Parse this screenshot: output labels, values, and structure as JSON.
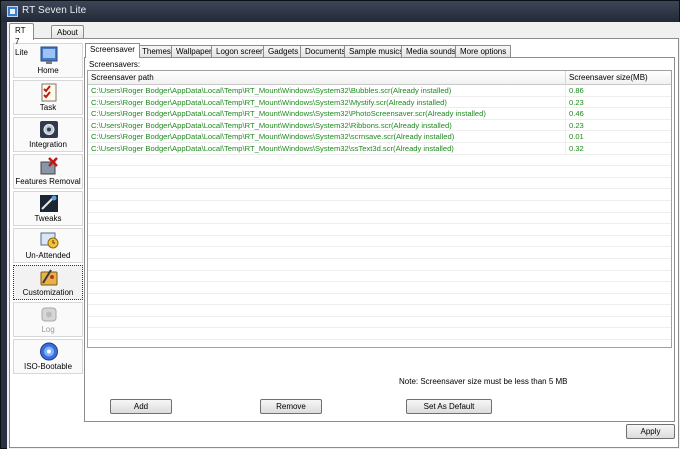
{
  "window": {
    "title": "RT Seven Lite"
  },
  "outer_tabs": [
    {
      "label": "RT 7 Lite",
      "active": true
    },
    {
      "label": "About",
      "active": false
    }
  ],
  "sidebar": {
    "items": [
      {
        "label": "Home",
        "icon": "home-icon"
      },
      {
        "label": "Task",
        "icon": "task-checklist-icon"
      },
      {
        "label": "Integration",
        "icon": "integration-gear-icon"
      },
      {
        "label": "Features Removal",
        "icon": "features-removal-icon"
      },
      {
        "label": "Tweaks",
        "icon": "tweaks-icon"
      },
      {
        "label": "Un-Attended",
        "icon": "unattended-icon"
      },
      {
        "label": "Customization",
        "icon": "customization-icon",
        "selected": true
      },
      {
        "label": "Log",
        "icon": "log-icon",
        "disabled": true
      },
      {
        "label": "ISO-Bootable",
        "icon": "iso-disc-icon"
      }
    ]
  },
  "inner_tabs": [
    {
      "label": "Screensaver",
      "active": true
    },
    {
      "label": "Themes"
    },
    {
      "label": "Wallpaper"
    },
    {
      "label": "Logon screen"
    },
    {
      "label": "Gadgets"
    },
    {
      "label": "Documents"
    },
    {
      "label": "Sample musics"
    },
    {
      "label": "Media sounds"
    },
    {
      "label": "More options"
    }
  ],
  "screensaver": {
    "group_label": "Screensavers:",
    "columns": [
      "Screensaver path",
      "Screensaver size(MB)"
    ],
    "rows": [
      {
        "path": "C:\\Users\\Roger Bodger\\AppData\\Local\\Temp\\RT_Mount\\Windows\\System32\\Bubbles.scr(Already installed)",
        "size": "0.86"
      },
      {
        "path": "C:\\Users\\Roger Bodger\\AppData\\Local\\Temp\\RT_Mount\\Windows\\System32\\Mystify.scr(Already installed)",
        "size": "0.23"
      },
      {
        "path": "C:\\Users\\Roger Bodger\\AppData\\Local\\Temp\\RT_Mount\\Windows\\System32\\PhotoScreensaver.scr(Already installed)",
        "size": "0.46"
      },
      {
        "path": "C:\\Users\\Roger Bodger\\AppData\\Local\\Temp\\RT_Mount\\Windows\\System32\\Ribbons.scr(Already installed)",
        "size": "0.23"
      },
      {
        "path": "C:\\Users\\Roger Bodger\\AppData\\Local\\Temp\\RT_Mount\\Windows\\System32\\scrnsave.scr(Already installed)",
        "size": "0.01"
      },
      {
        "path": "C:\\Users\\Roger Bodger\\AppData\\Local\\Temp\\RT_Mount\\Windows\\System32\\ssText3d.scr(Already installed)",
        "size": "0.32"
      }
    ],
    "note": "Note: Screensaver size must be less than 5 MB",
    "buttons": {
      "add": "Add",
      "remove": "Remove",
      "set_default": "Set As Default"
    }
  },
  "footer": {
    "apply": "Apply"
  },
  "colors": {
    "row_text": "#1e8a1e",
    "title_bar": "#2a3241"
  }
}
